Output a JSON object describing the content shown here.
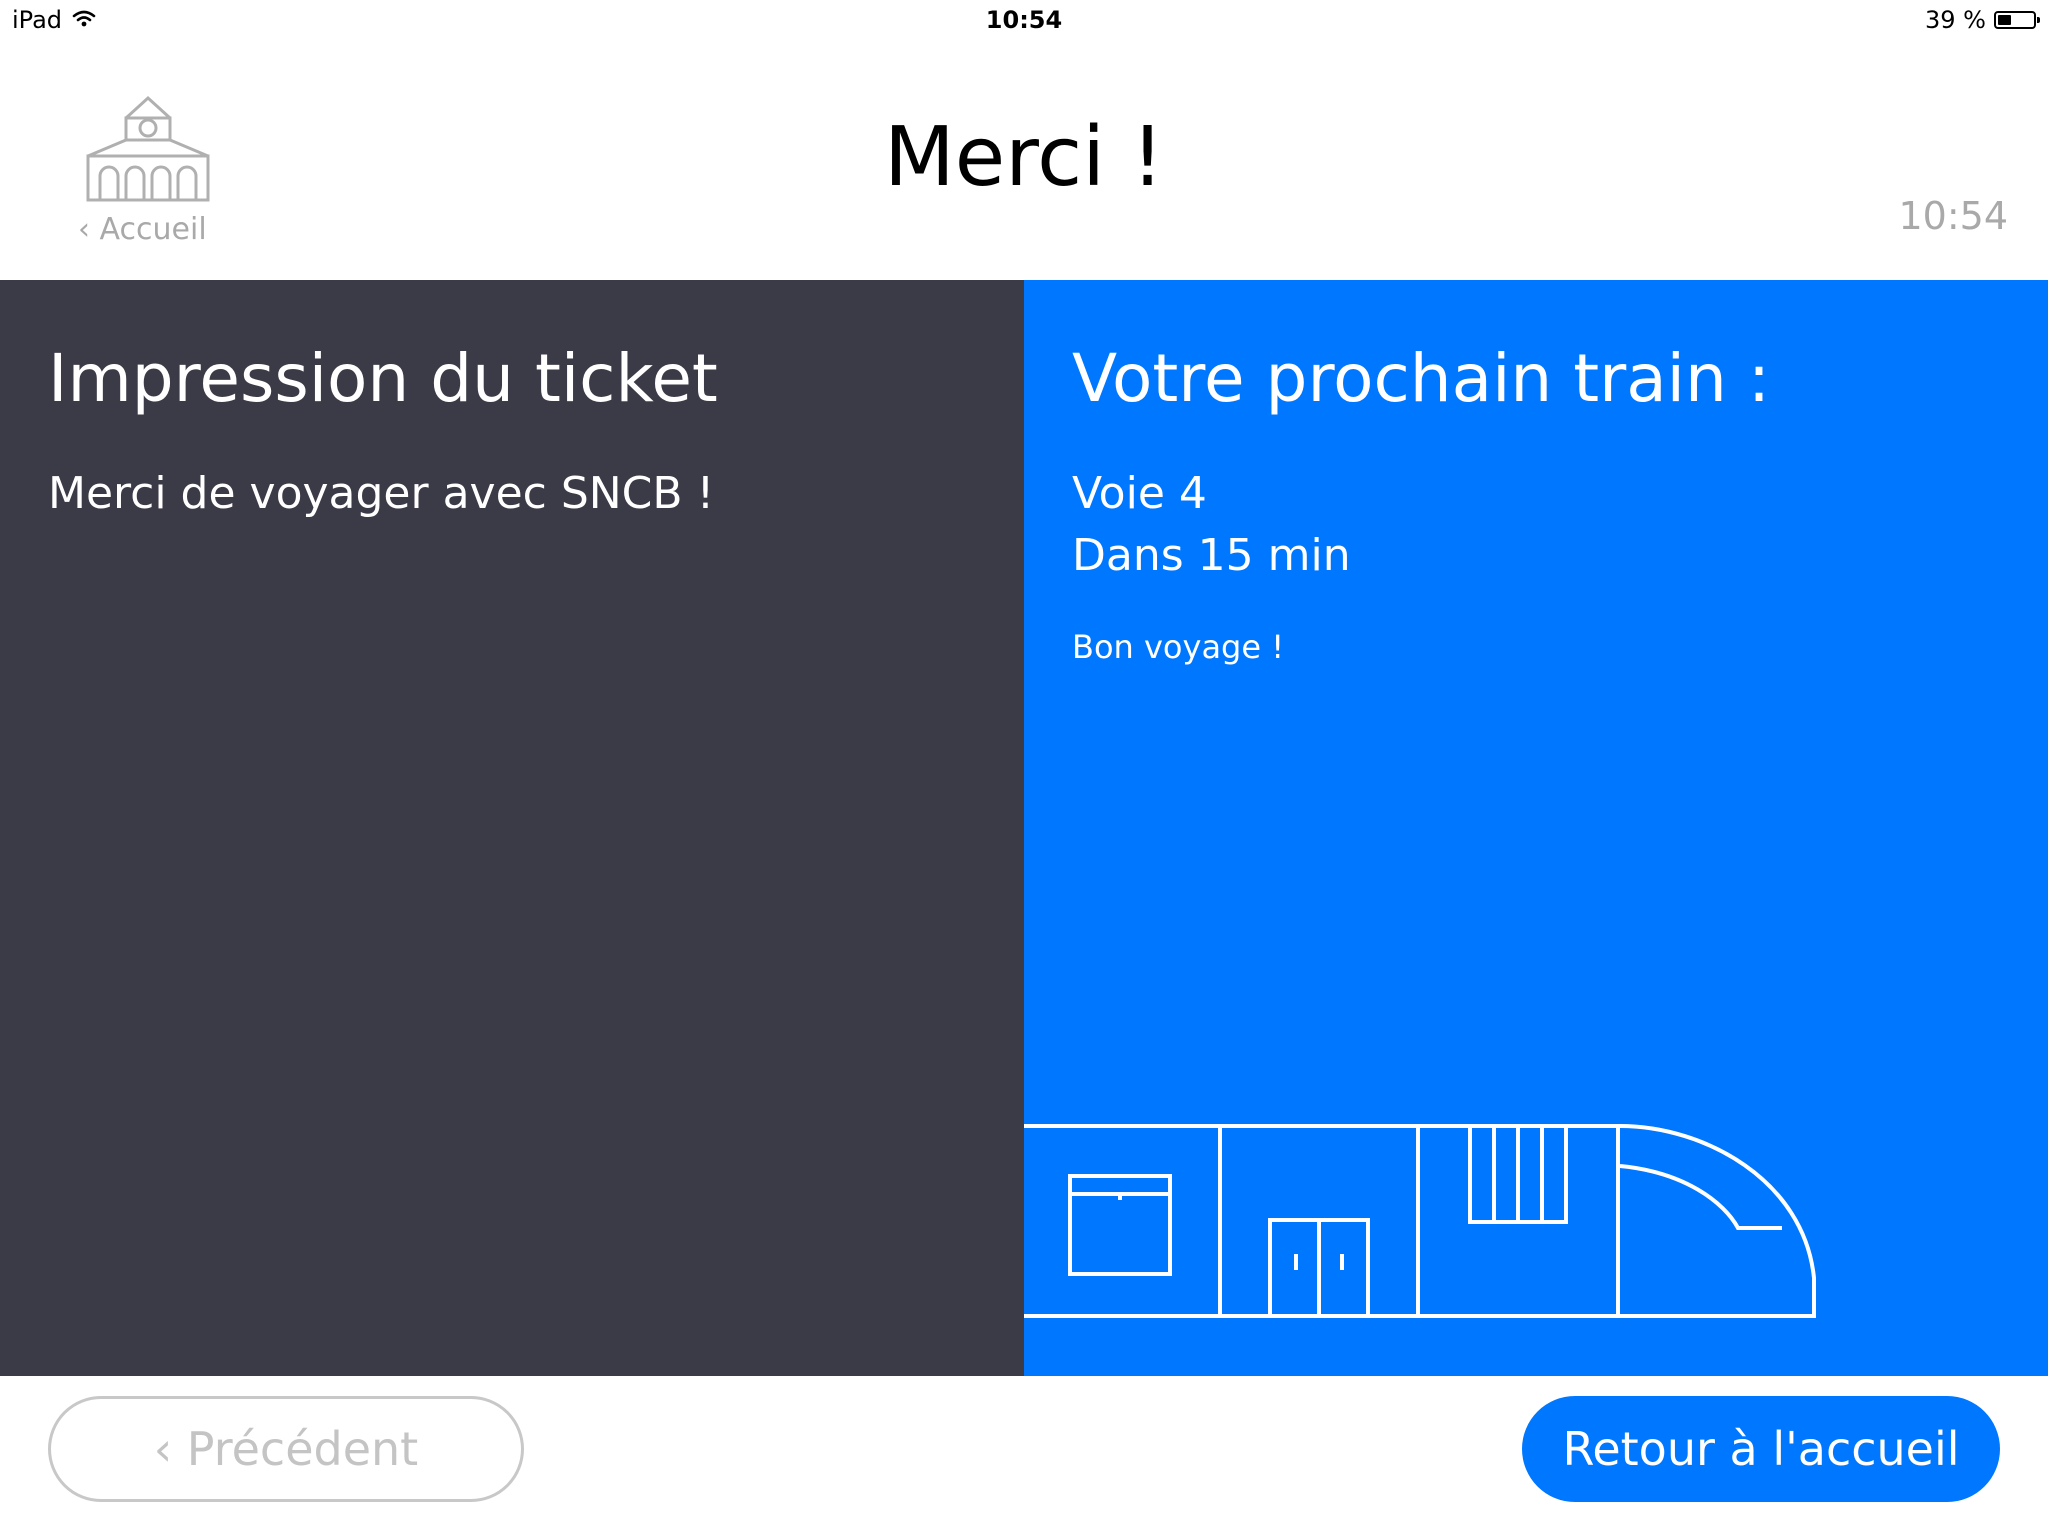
{
  "status_bar": {
    "device": "iPad",
    "time": "10:54",
    "battery": "39 %",
    "battery_level": 0.39
  },
  "header": {
    "home_label": "‹ Accueil",
    "title": "Merci !",
    "time": "10:54"
  },
  "left_panel": {
    "title": "Impression du ticket",
    "message": "Merci de voyager avec SNCB !"
  },
  "right_panel": {
    "title": "Votre prochain train :",
    "platform": "Voie 4",
    "eta": "Dans 15 min",
    "greeting": "Bon voyage !"
  },
  "footer": {
    "prev_label": "‹ Précédent",
    "home_label": "Retour à l'accueil"
  },
  "colors": {
    "dark_panel": "#3b3a47",
    "accent_blue": "#0077ff",
    "muted_gray": "#a9a9a9"
  }
}
